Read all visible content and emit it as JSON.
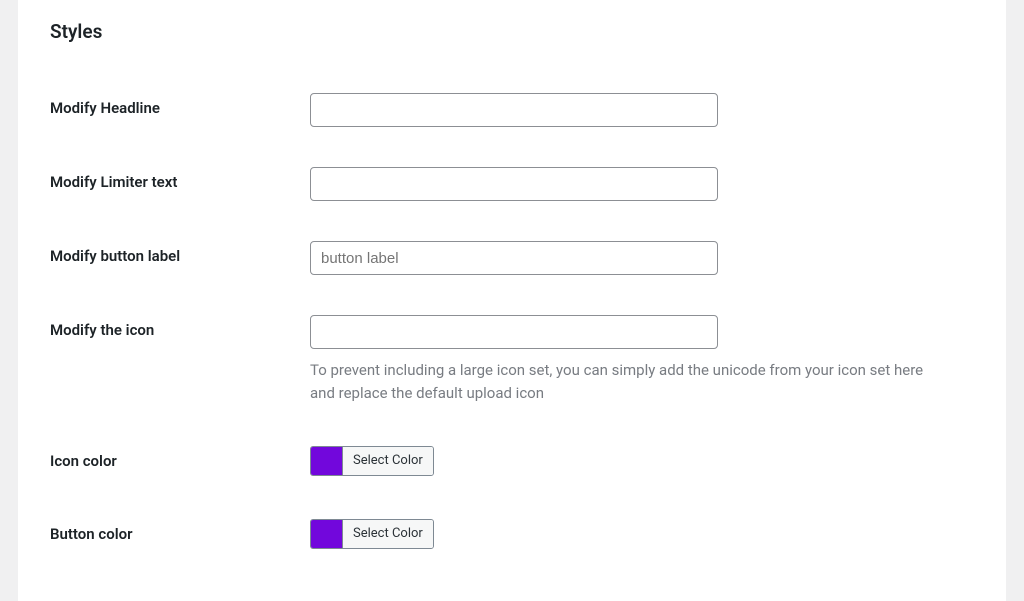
{
  "section": {
    "title": "Styles"
  },
  "fields": {
    "headline": {
      "label": "Modify Headline",
      "value": ""
    },
    "limiter": {
      "label": "Modify Limiter text",
      "value": ""
    },
    "button_label": {
      "label": "Modify button label",
      "placeholder": "button label",
      "value": ""
    },
    "icon": {
      "label": "Modify the icon",
      "value": "",
      "description": "To prevent including a large icon set, you can simply add the unicode from your icon set here and replace the default upload icon"
    },
    "icon_color": {
      "label": "Icon color",
      "value": "#7207dc",
      "button": "Select Color"
    },
    "button_color": {
      "label": "Button color",
      "value": "#7207dc",
      "button": "Select Color"
    }
  }
}
